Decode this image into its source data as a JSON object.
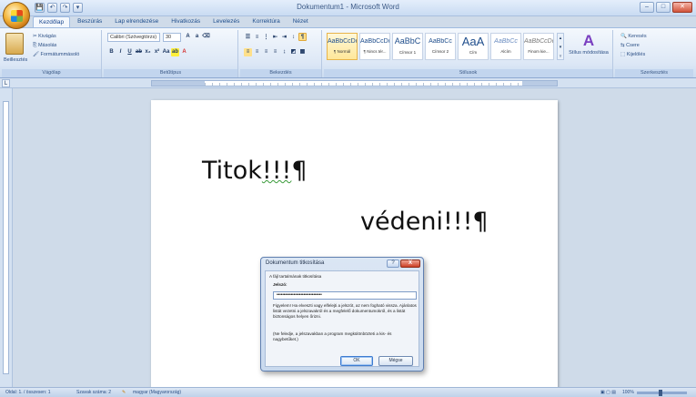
{
  "window": {
    "title": "Dokumentum1 - Microsoft Word"
  },
  "quick_access": {
    "save": "💾",
    "undo": "↶",
    "redo": "↷",
    "more": "▾"
  },
  "window_controls": {
    "minimize": "–",
    "maximize": "□",
    "close": "✕"
  },
  "ribbon": {
    "tabs": [
      "Kezdőlap",
      "Beszúrás",
      "Lap elrendezése",
      "Hivatkozás",
      "Levelezés",
      "Korrektúra",
      "Nézet"
    ],
    "active_tab": "Kezdőlap",
    "clipboard": {
      "paste": "Beillesztés",
      "cut": "Kivágás",
      "copy": "Másolás",
      "format_painter": "Formátummásoló",
      "label": "Vágólap"
    },
    "font": {
      "name": "Calibri (Szövegtörzs)",
      "size": "30",
      "label": "Betűtípus"
    },
    "paragraph": {
      "label": "Bekezdés"
    },
    "styles": {
      "label": "Stílusok",
      "items": [
        {
          "sample": "AaBbCcDd",
          "name": "¶ Normál"
        },
        {
          "sample": "AaBbCcDd",
          "name": "¶ Nincs tér..."
        },
        {
          "sample": "AaBbC",
          "name": "Címsor 1"
        },
        {
          "sample": "AaBbCc",
          "name": "Címsor 2"
        },
        {
          "sample": "AaA",
          "name": "Cím"
        },
        {
          "sample": "AaBbCc",
          "name": "Alcím"
        },
        {
          "sample": "AaBbCcDd",
          "name": "Finom kie..."
        }
      ],
      "change_styles": "Stílus módosítása"
    },
    "editing": {
      "label": "Szerkesztés",
      "find": "Keresés",
      "replace": "Csere",
      "select": "Kijelölés"
    }
  },
  "document": {
    "line1": "Titok!!!¶",
    "line2": "védeni!!!¶"
  },
  "dialog": {
    "title": "Dokumentum titkosítása",
    "section": "A fájl tartalmának titkosítása",
    "password_label": "Jelszó:",
    "password_value": "••••••••••••••••••••••••••••••••",
    "warning": "Figyelem! Ha elveszti vagy elfelejti a jelszót, az nem fogható vissza. Ajánlatos listát vezetni a jelszavakról és a megfelelő dokumentumokról, és a listát biztonságos helyen őrizni.",
    "note": "(Ne feledje, a jelszavakban a program megkülönbözteti a kis- és nagybetűket.)",
    "ok": "OK",
    "cancel": "Mégse",
    "help": "?",
    "close": "X"
  },
  "statusbar": {
    "page": "Oldal: 1. / összesen: 1",
    "words": "Szavak száma: 2",
    "language": "magyar (Magyarország)",
    "zoom": "100%"
  }
}
